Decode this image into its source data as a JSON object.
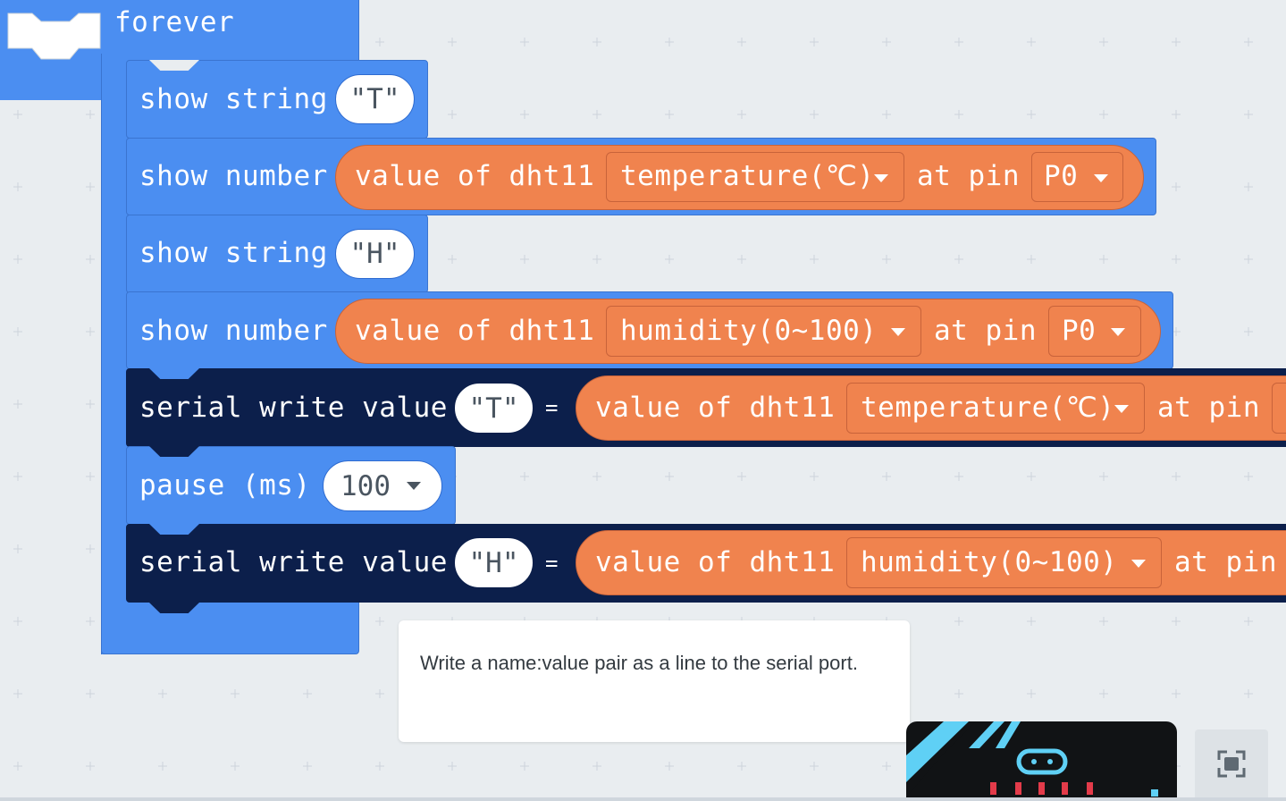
{
  "colors": {
    "canvas": "#e9edf0",
    "basic_blue": "#4b8ef1",
    "serial_navy": "#0c1f4b",
    "dht11_orange": "#f0834e",
    "tooltip_bg": "#ffffff"
  },
  "forever_block": {
    "label": "forever",
    "statements": [
      {
        "type": "show string",
        "label": "show string",
        "value": "\"T\""
      },
      {
        "type": "show number",
        "label": "show number",
        "reporter": {
          "label": "value of dht11",
          "measure": "temperature(℃)",
          "at_pin": "at pin",
          "pin": "P0"
        }
      },
      {
        "type": "show string",
        "label": "show string",
        "value": "\"H\""
      },
      {
        "type": "show number",
        "label": "show number",
        "reporter": {
          "label": "value of dht11",
          "measure": "humidity(0~100)",
          "at_pin": "at pin",
          "pin": "P0"
        }
      },
      {
        "type": "serial write value",
        "label": "serial write value",
        "name": "\"T\"",
        "equals": "=",
        "reporter": {
          "label": "value of dht11",
          "measure": "temperature(℃)",
          "at_pin": "at pin"
        }
      },
      {
        "type": "pause",
        "label": "pause (ms)",
        "value": "100"
      },
      {
        "type": "serial write value",
        "label": "serial write value",
        "name": "\"H\"",
        "equals": "=",
        "reporter": {
          "label": "value of dht11",
          "measure": "humidity(0~100)",
          "at_pin": "at pin"
        }
      }
    ]
  },
  "tooltip": {
    "text": "Write a name:value pair as a line to the serial port."
  },
  "icons": {
    "fullscreen": "fullscreen-icon",
    "simulator": "microbit-simulator"
  }
}
